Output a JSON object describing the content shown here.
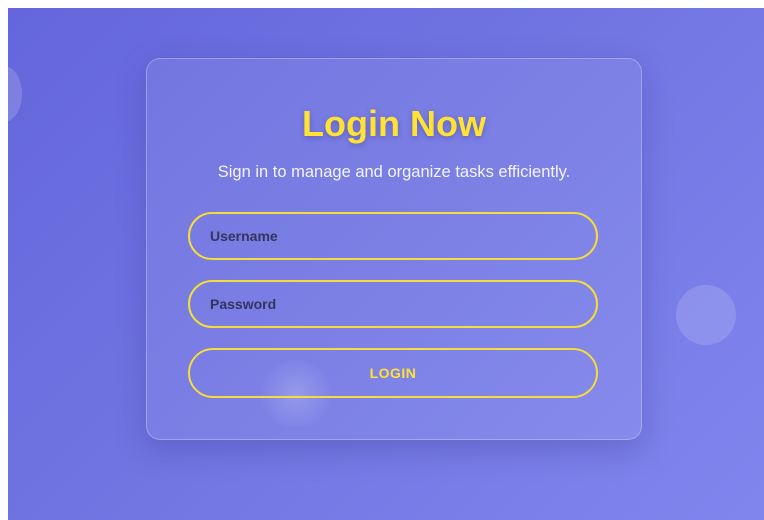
{
  "login": {
    "title": "Login Now",
    "subtitle": "Sign in to manage and organize tasks efficiently.",
    "username_placeholder": "Username",
    "password_placeholder": "Password",
    "button_label": "LOGIN"
  },
  "colors": {
    "accent": "#ffe234",
    "border": "#f5dc3a",
    "background_start": "#6466db",
    "background_end": "#8085ee"
  }
}
